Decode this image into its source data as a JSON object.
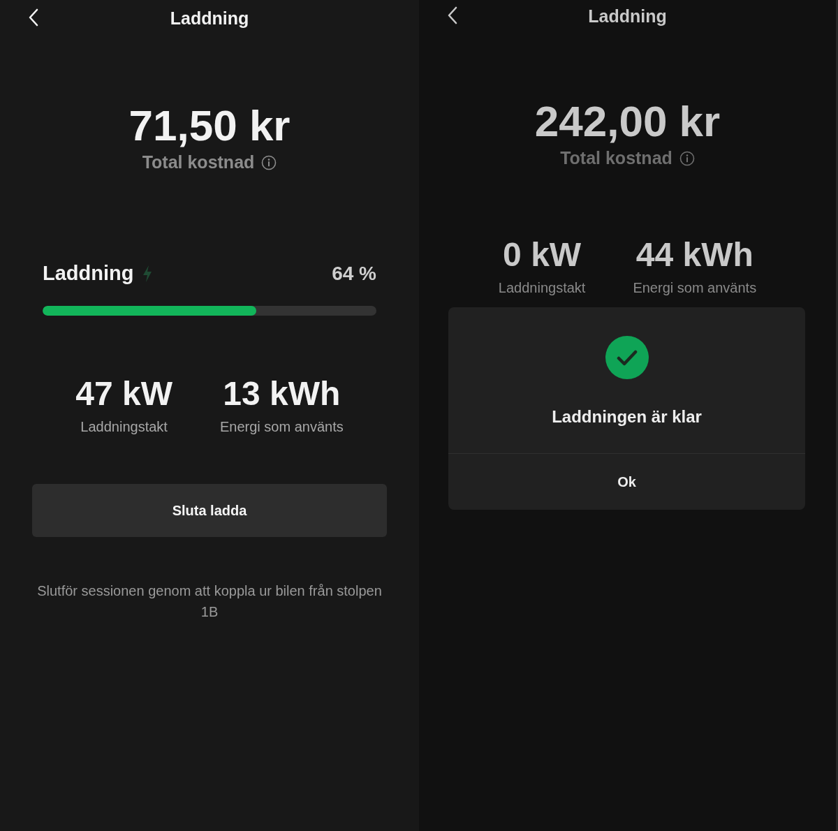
{
  "screens": [
    {
      "title": "Laddning",
      "amount": "71,50 kr",
      "amount_label": "Total kostnad",
      "progress": {
        "label": "Laddning",
        "reading": "64 %",
        "level": 0.64,
        "charging": true
      },
      "stats": [
        {
          "value": "47 kW",
          "label": "Laddningstakt"
        },
        {
          "value": "13 kWh",
          "label": "Energi som använts"
        }
      ],
      "button": "Sluta ladda",
      "footer": "Slutför sessionen genom att koppla ur bilen från stolpen 1B"
    },
    {
      "title": "Laddning",
      "amount": "242,00 kr",
      "amount_label": "Total kostnad",
      "stats": [
        {
          "value": "0 kW",
          "label": "Laddningstakt"
        },
        {
          "value": "44 kWh",
          "label": "Energi som använts"
        }
      ],
      "dialog": {
        "message": "Laddningen är klar",
        "button": "Ok"
      }
    }
  ]
}
